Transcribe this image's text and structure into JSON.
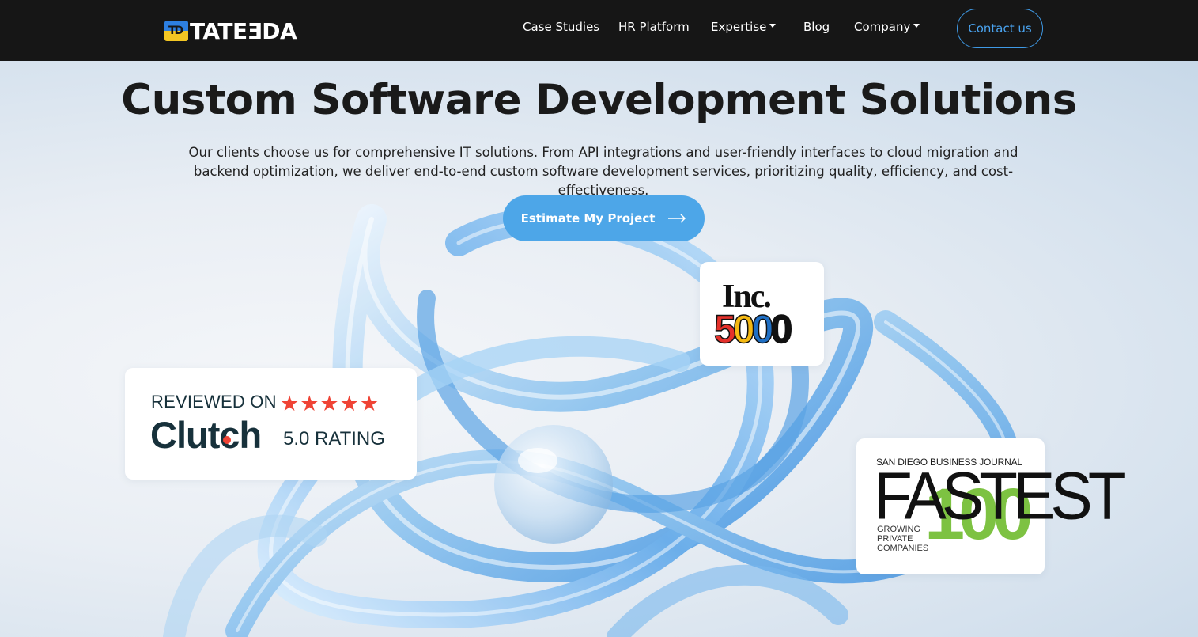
{
  "nav": {
    "logo_text": "TATEƎDA",
    "logo_mark": "TD",
    "links": [
      {
        "label": "Case Studies"
      },
      {
        "label": "HR Platform"
      },
      {
        "label": "Expertise"
      },
      {
        "label": "Blog"
      },
      {
        "label": "Company"
      }
    ],
    "contact_label": "Contact us"
  },
  "hero": {
    "title": "Custom Software Development Solutions",
    "subtitle": "Our clients choose us for comprehensive IT solutions. From API integrations and user-friendly interfaces to cloud migration and backend optimization, we deliver end-to-end custom software development services, prioritizing quality, efficiency, and cost-effectiveness.",
    "cta_label": "Estimate My Project"
  },
  "badges": {
    "clutch": {
      "reviewed": "REVIEWED ON",
      "brand": "Clutch",
      "stars": "★★★★★",
      "rating_text": "5.0 RATING",
      "rating_value": 5.0,
      "star_color": "#ef4335"
    },
    "inc": {
      "word": "Inc.",
      "number": "5000",
      "digit_colors": [
        "#e5312b",
        "#f5b912",
        "#1f6fc4",
        "#111111"
      ]
    },
    "fastest": {
      "publisher": "SAN DIEGO BUSINESS JOURNAL",
      "word": "FASTEST",
      "number": "100",
      "tagline_lines": [
        "GROWING",
        "PRIVATE",
        "COMPANIES"
      ],
      "accent": "#7dc242"
    }
  },
  "colors": {
    "nav_bg": "#161616",
    "accent": "#4da6e8"
  }
}
